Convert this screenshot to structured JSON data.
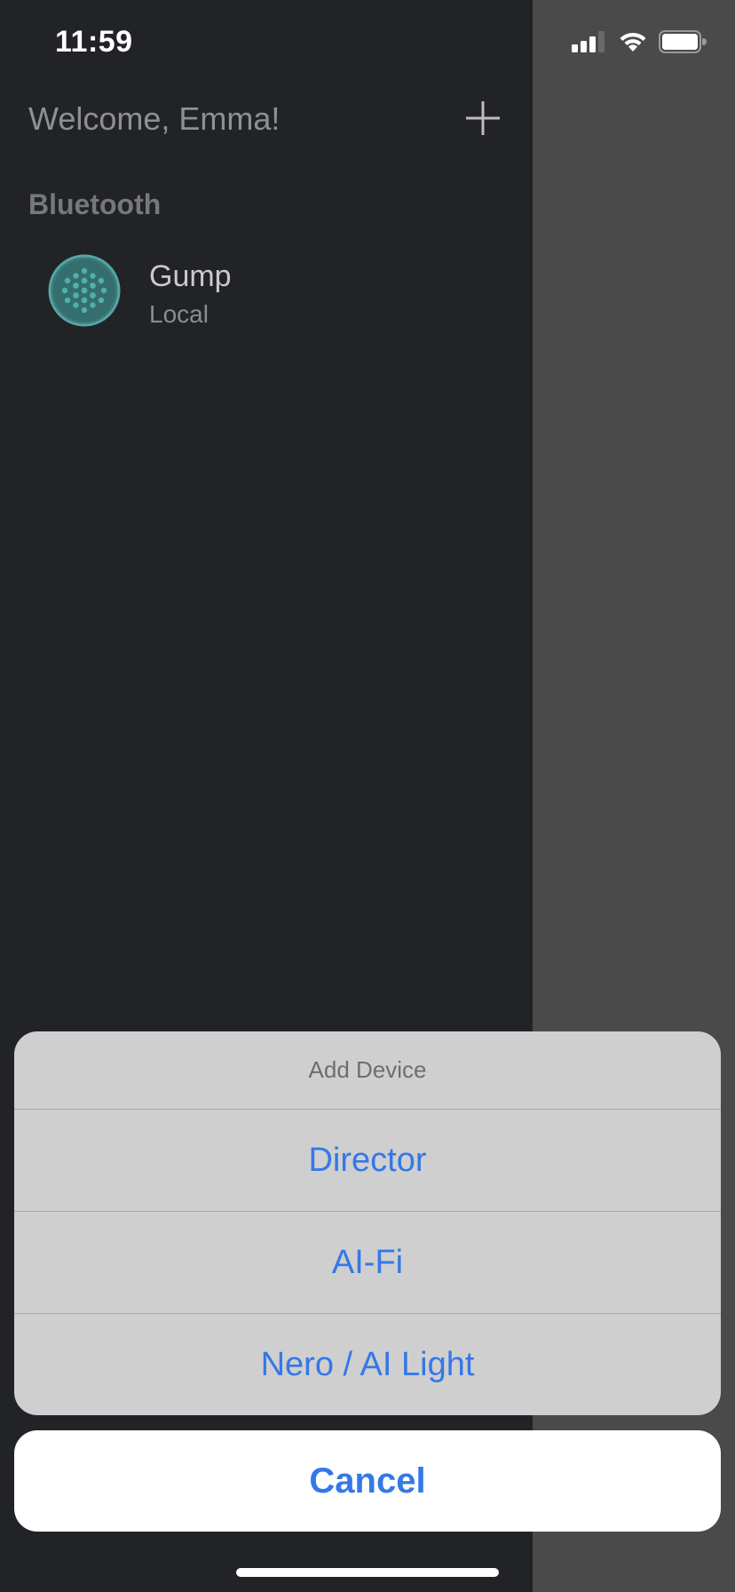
{
  "status_bar": {
    "time": "11:59",
    "icons": [
      "cellular-signal-icon",
      "wifi-icon",
      "battery-icon"
    ]
  },
  "header": {
    "welcome_text": "Welcome, Emma!",
    "add_icon": "plus-icon"
  },
  "sections": [
    {
      "label": "Bluetooth",
      "devices": [
        {
          "name": "Gump",
          "subtitle": "Local",
          "icon": "speaker-grille-icon"
        }
      ]
    }
  ],
  "action_sheet": {
    "title": "Add Device",
    "options": [
      "Director",
      "AI-Fi",
      "Nero / AI Light"
    ],
    "cancel_label": "Cancel"
  },
  "colors": {
    "background": "#222326",
    "side_panel": "#4a4a4b",
    "accent_blue": "#3478e6",
    "device_teal": "#3c7a7a"
  }
}
